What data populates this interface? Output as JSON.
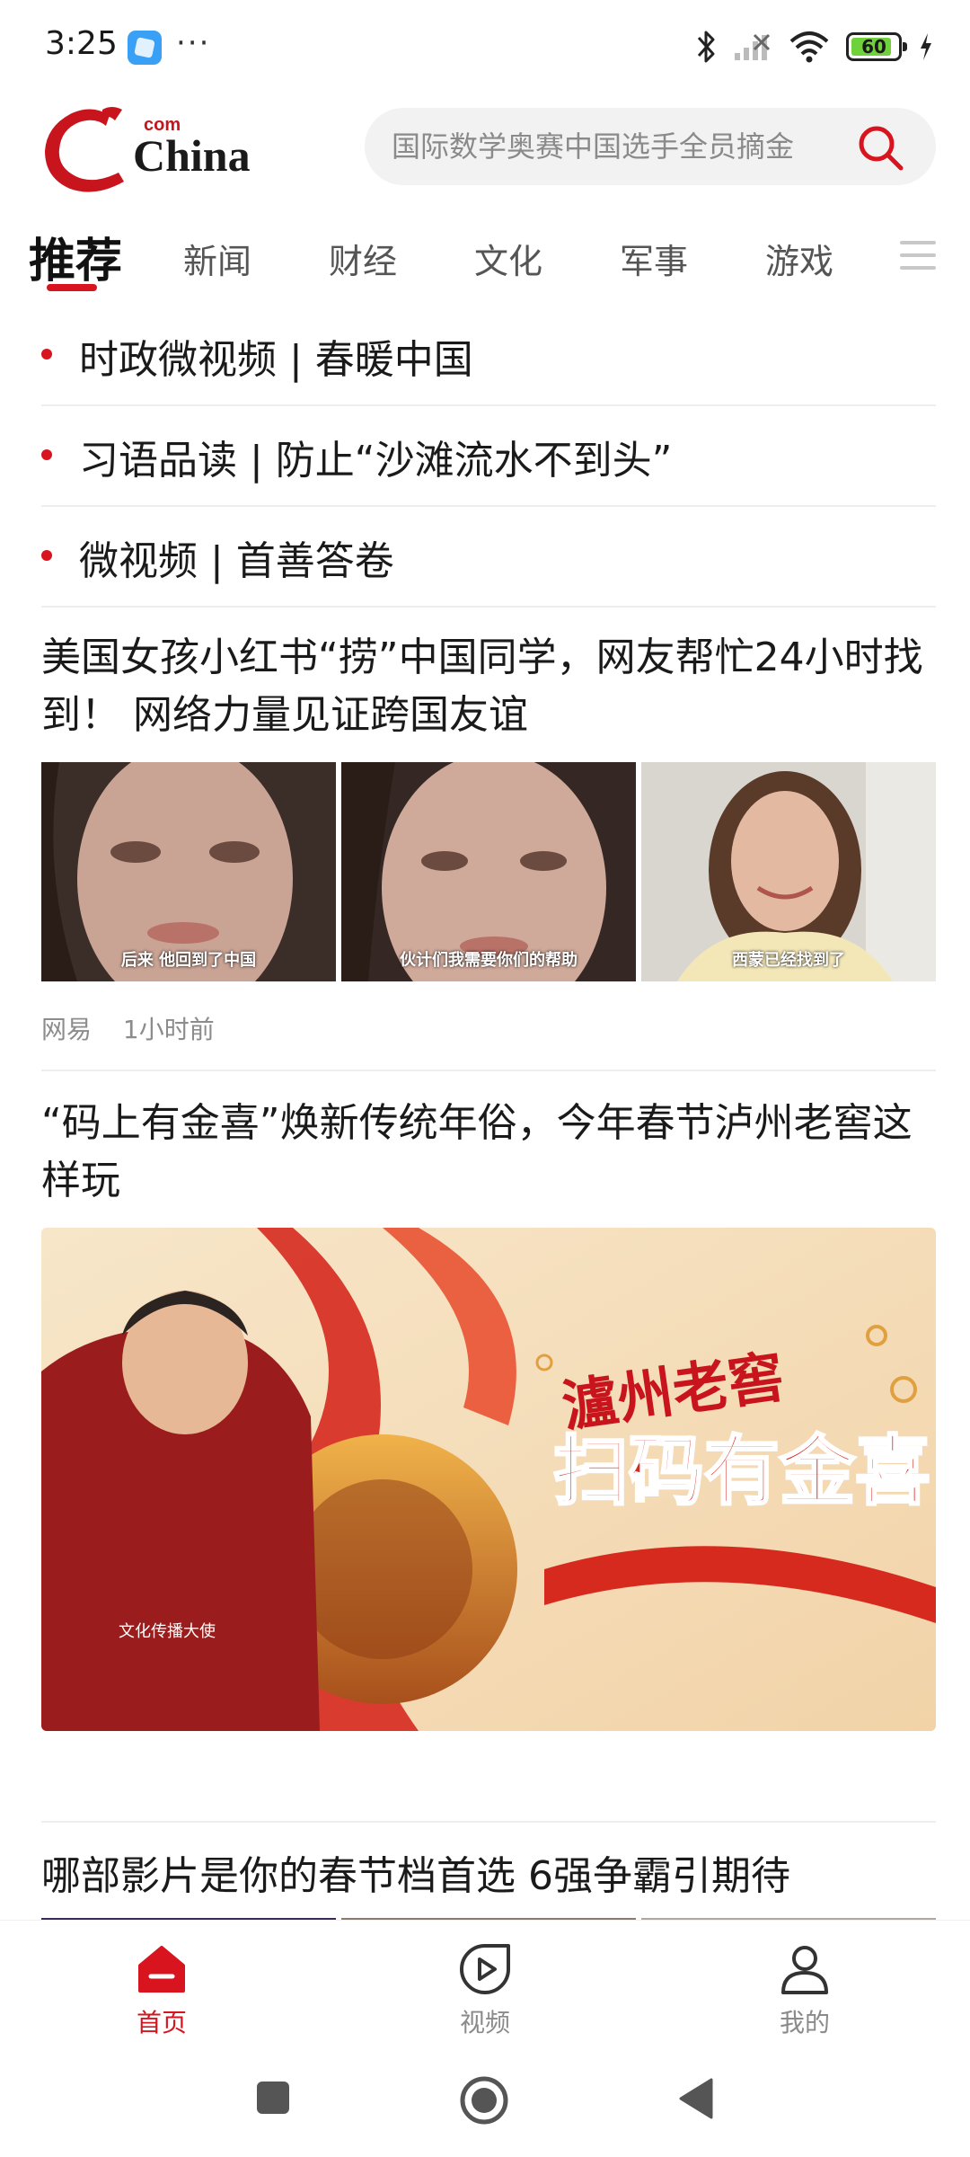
{
  "status_bar": {
    "time": "3:25",
    "dots": "···",
    "battery_level": "60",
    "icons": [
      "bluetooth-icon",
      "signal-icon",
      "wifi-icon",
      "battery-icon",
      "charging-icon"
    ]
  },
  "header": {
    "logo_text": "China",
    "logo_suffix": "com",
    "search_placeholder": "国际数学奥赛中国选手全员摘金",
    "accent_color": "#d8141e"
  },
  "tabs": [
    {
      "label": "推荐",
      "active": true
    },
    {
      "label": "新闻"
    },
    {
      "label": "财经"
    },
    {
      "label": "文化"
    },
    {
      "label": "军事"
    },
    {
      "label": "游戏"
    }
  ],
  "bullet_links": [
    {
      "label": "时政微视频 | 春暖中国"
    },
    {
      "label": "习语品读 | 防止“沙滩流水不到头”"
    },
    {
      "label": "微视频 | 首善答卷"
    }
  ],
  "articles": [
    {
      "title": "美国女孩小红书“捞”中国同学，网友帮忙24小时找到！ 网络力量见证跨国友谊",
      "thumb_captions": [
        "后来 他回到了中国",
        "伙计们我需要你们的帮助",
        "西蒙已经找到了"
      ],
      "source": "网易",
      "time": "1小时前"
    },
    {
      "title": "“码上有金喜”焕新传统年俗，今年春节泸州老窖这样玩",
      "banner_brand": "瀘州老窖",
      "banner_slogan": "扫码有金喜",
      "banner_caption": "文化传播大使"
    },
    {
      "title": "哪部影片是你的春节档首选 6强争霸引期待"
    }
  ],
  "bottom_nav": [
    {
      "label": "首页",
      "icon": "home-icon",
      "active": true
    },
    {
      "label": "视频",
      "icon": "video-play-icon"
    },
    {
      "label": "我的",
      "icon": "profile-icon"
    }
  ]
}
